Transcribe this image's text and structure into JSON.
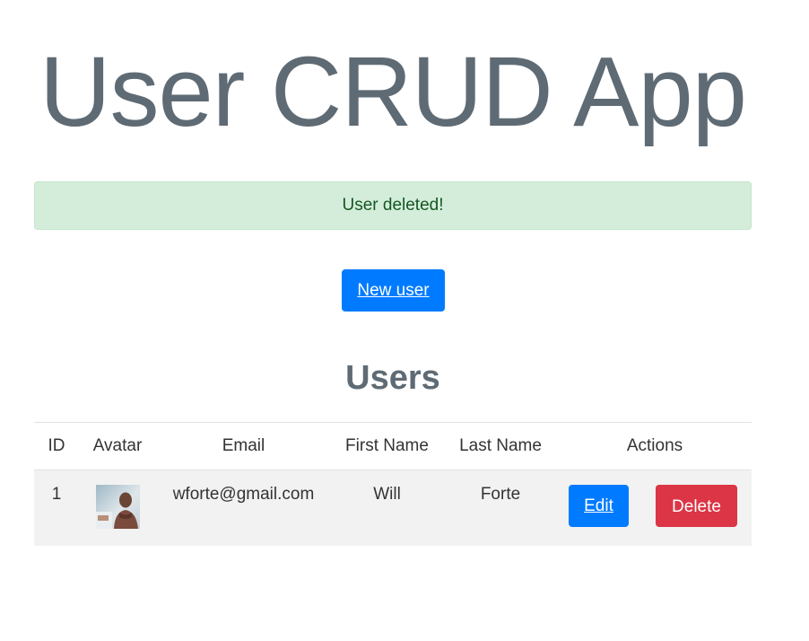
{
  "app": {
    "title": "User CRUD App"
  },
  "alert": {
    "message": "User deleted!",
    "color": "#d4edda"
  },
  "toolbar": {
    "new_user_label": "New user"
  },
  "users_section": {
    "heading": "Users",
    "columns": [
      "ID",
      "Avatar",
      "Email",
      "First Name",
      "Last Name",
      "Actions"
    ],
    "rows": [
      {
        "id": "1",
        "avatar_icon": "user-photo",
        "email": "wforte@gmail.com",
        "first_name": "Will",
        "last_name": "Forte",
        "edit_label": "Edit",
        "delete_label": "Delete"
      }
    ]
  },
  "colors": {
    "primary": "#007bff",
    "danger": "#dc3545",
    "success_bg": "#d4edda",
    "success_text": "#155724",
    "heading": "#5f6b74"
  }
}
